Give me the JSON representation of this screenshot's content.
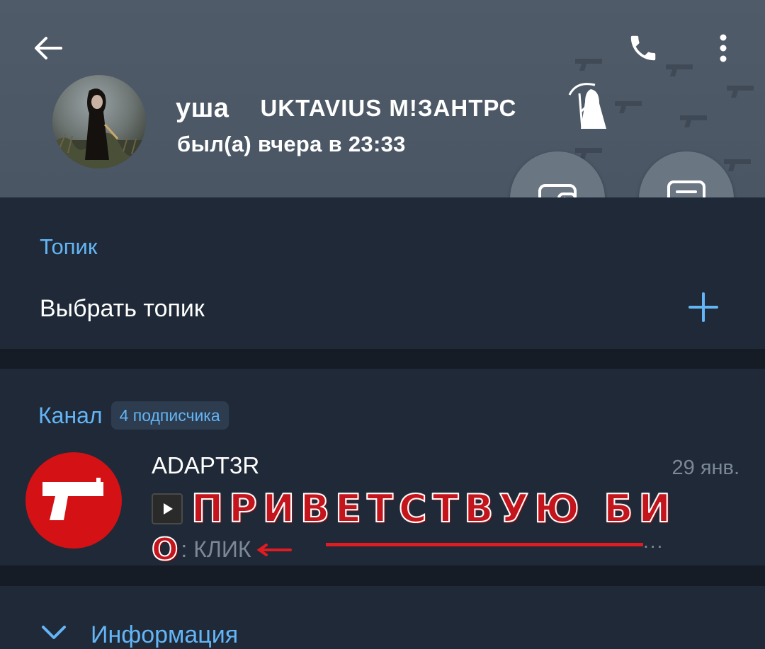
{
  "header": {
    "name": "уша",
    "name_suffix": "UKTAVIUS M!ЗАНТРС",
    "status": "был(а) вчера в 23:33",
    "icons": {
      "back": "arrow-left-icon",
      "call": "phone-icon",
      "more": "more-vertical-icon",
      "name_decoration": "grim-reaper-icon"
    }
  },
  "actions": {
    "wallet_icon": "wallet-icon",
    "chat_icon": "message-icon"
  },
  "topic": {
    "title": "Топик",
    "select_label": "Выбрать топик",
    "add_icon": "plus-icon"
  },
  "channel": {
    "title": "Канал",
    "subscribers": "4 подписчика",
    "name": "ADAPT3R",
    "date": "29 янв.",
    "preview_big": "ПРИВЕТСТВУЮ БИ",
    "preview_o": "О",
    "preview_click": ": КЛИК",
    "preview_more": "..."
  },
  "info": {
    "title": "Информация",
    "chevron_icon": "chevron-down-icon"
  },
  "colors": {
    "header_bg": "#4f5b69",
    "section_bg": "#1f2937",
    "accent": "#64b5f6",
    "channel_avatar": "#d41216"
  }
}
